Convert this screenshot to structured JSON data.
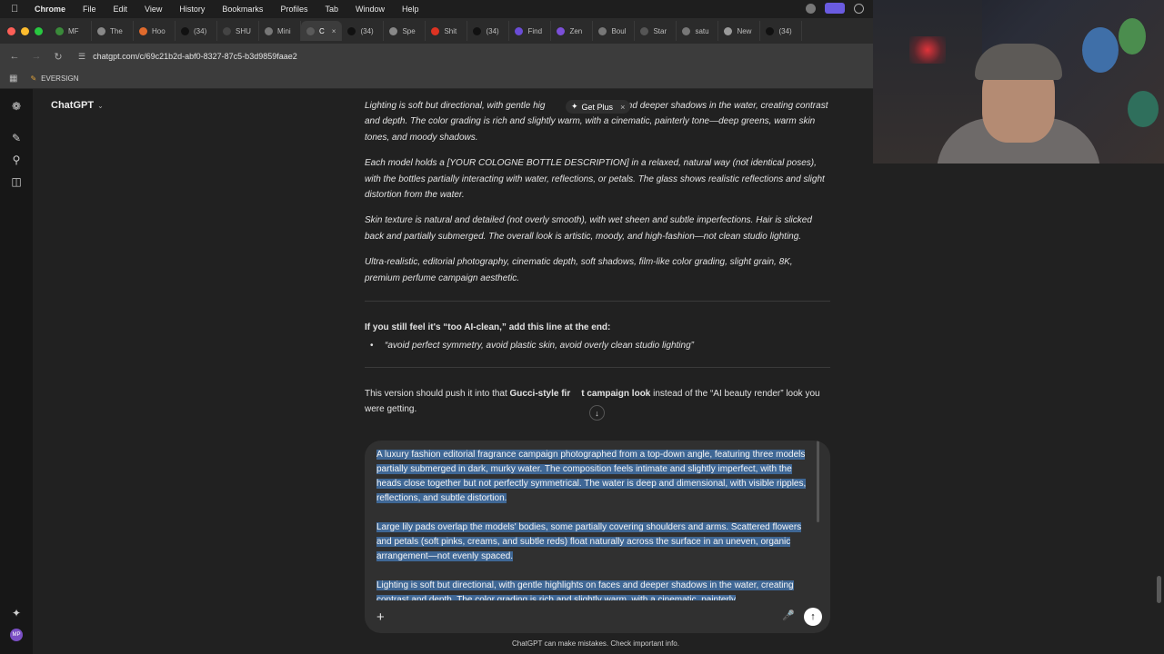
{
  "menubar": {
    "items": [
      "Chrome",
      "File",
      "Edit",
      "View",
      "History",
      "Bookmarks",
      "Profiles",
      "Tab",
      "Window",
      "Help"
    ]
  },
  "tabs": [
    {
      "label": "MF"
    },
    {
      "label": "The"
    },
    {
      "label": "Hoo"
    },
    {
      "label": "(34)"
    },
    {
      "label": "SHU"
    },
    {
      "label": "Mini"
    },
    {
      "label": "C",
      "active": true
    },
    {
      "label": "(34)"
    },
    {
      "label": "Spe"
    },
    {
      "label": "Shit"
    },
    {
      "label": "(34)"
    },
    {
      "label": "Find"
    },
    {
      "label": "Zen"
    },
    {
      "label": "Boul"
    },
    {
      "label": "Star"
    },
    {
      "label": "satu"
    },
    {
      "label": "New"
    },
    {
      "label": "(34)"
    }
  ],
  "address": {
    "url": "chatgpt.com/c/69c21b2d-abf0-8327-87c5-b3d9859faae2"
  },
  "bookmarks": {
    "item": "EVERSIGN"
  },
  "sidebar": {
    "brand": "ChatGPT"
  },
  "getplus": {
    "label": "Get Plus",
    "close": "×"
  },
  "content": {
    "para1_a": "Lighting is soft but directional, with gentle hig",
    "para1_b": "s and deeper shadows in the water, creating contrast and depth. The color grading is rich and slightly warm, with a cinematic, painterly tone—deep greens, warm skin tones, and moody shadows.",
    "para2": "Each model holds a [YOUR COLOGNE BOTTLE DESCRIPTION] in a relaxed, natural way (not identical poses), with the bottles partially interacting with water, reflections, or petals. The glass shows realistic reflections and slight distortion from the water.",
    "para3": "Skin texture is natural and detailed (not overly smooth), with wet sheen and subtle imperfections. Hair is slicked back and partially submerged. The overall look is artistic, moody, and high-fashion—not clean studio lighting.",
    "para4": "Ultra-realistic, editorial photography, cinematic depth, soft shadows, film-like color grading, slight grain, 8K, premium perfume campaign aesthetic.",
    "tip_title": "If you still feel it's “too AI-clean,” add this line at the end:",
    "tip_bullet": "“avoid perfect symmetry, avoid plastic skin, avoid overly clean studio lighting”",
    "closing_a": "This version should push it into that ",
    "closing_b": "Gucci-style fir",
    "closing_c": "t campaign look",
    "closing_d": " instead of the “AI beauty render” look you were getting."
  },
  "composer": {
    "p1": "A luxury fashion editorial fragrance campaign photographed from a top-down angle, featuring three models partially submerged in dark, murky water. The composition feels intimate and slightly imperfect, with the heads close together but not perfectly symmetrical. The water is deep and dimensional, with visible ripples, reflections, and subtle distortion.",
    "p2": "Large lily pads overlap the models' bodies, some partially covering shoulders and arms. Scattered flowers and petals (soft pinks, creams, and subtle reds) float naturally across the surface in an uneven, organic arrangement—not evenly spaced.",
    "p3": "Lighting is soft but directional, with gentle highlights on faces and deeper shadows in the water, creating contrast and depth. The color grading is rich and slightly warm, with a cinematic, painterly"
  },
  "footer": {
    "disclaimer": "ChatGPT can make mistakes. Check important info."
  }
}
